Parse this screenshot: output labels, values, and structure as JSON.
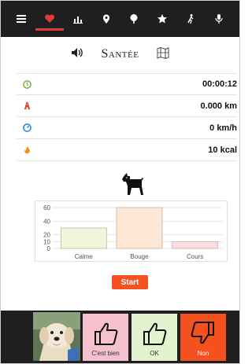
{
  "nav": {
    "items": [
      {
        "icon": "menu-icon",
        "active": false
      },
      {
        "icon": "heart-icon",
        "active": true
      },
      {
        "icon": "stats-icon",
        "active": false
      },
      {
        "icon": "location-pin-icon",
        "active": false
      },
      {
        "icon": "tree-icon",
        "active": false
      },
      {
        "icon": "star-icon",
        "active": false
      },
      {
        "icon": "walker-icon",
        "active": false
      },
      {
        "icon": "microphone-icon",
        "active": false
      }
    ],
    "accent": "#e53935"
  },
  "header": {
    "title": "Santée"
  },
  "stats": [
    {
      "icon": "timer-icon",
      "color": "#7cb342",
      "value": "00:00:12"
    },
    {
      "icon": "road-icon",
      "color": "#e53935",
      "value": "0.000 km"
    },
    {
      "icon": "speedometer-icon",
      "color": "#1e88e5",
      "value": "0 km/h"
    },
    {
      "icon": "flame-icon",
      "color": "#fb8c00",
      "value": "10 kcal"
    }
  ],
  "chart_data": {
    "type": "bar",
    "categories": [
      "Calme",
      "Bouge",
      "Cours"
    ],
    "values": [
      30,
      60,
      10
    ],
    "colors": [
      "#eef7dc",
      "#fde8d8",
      "#fbdde4"
    ],
    "ylim": [
      0,
      60
    ],
    "yticks": [
      "0",
      "10",
      "20",
      "40",
      "60"
    ],
    "grid": true
  },
  "start_label": "Start",
  "feedback": {
    "good_label": "C'est bien",
    "ok_label": "OK",
    "no_label": "Non"
  }
}
